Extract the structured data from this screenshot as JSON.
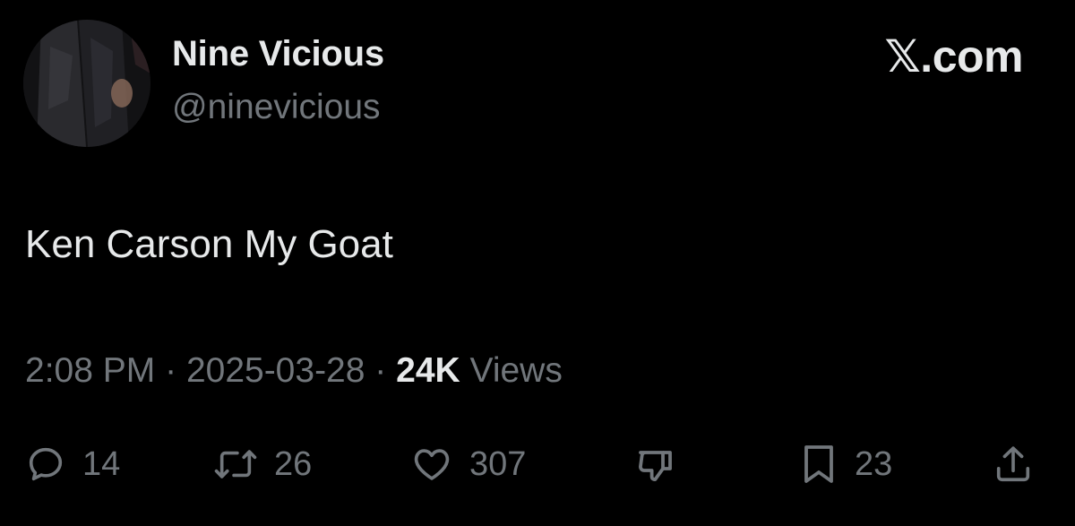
{
  "brand": "𝕏.com",
  "user": {
    "display_name": "Nine Vicious",
    "handle": "@ninevicious"
  },
  "tweet": {
    "text": "Ken Carson My Goat",
    "time": "2:08 PM",
    "separator": "·",
    "date": "2025-03-28",
    "views_count": "24K",
    "views_label": "Views"
  },
  "actions": {
    "replies": "14",
    "reposts": "26",
    "likes": "307",
    "bookmarks": "23"
  },
  "icons": {
    "reply": "reply-icon",
    "repost": "repost-icon",
    "like": "heart-icon",
    "dislike": "dislike-icon",
    "bookmark": "bookmark-icon",
    "share": "share-icon"
  },
  "colors": {
    "background": "#000000",
    "primary_text": "#e7e9ea",
    "secondary_text": "#71767b"
  }
}
